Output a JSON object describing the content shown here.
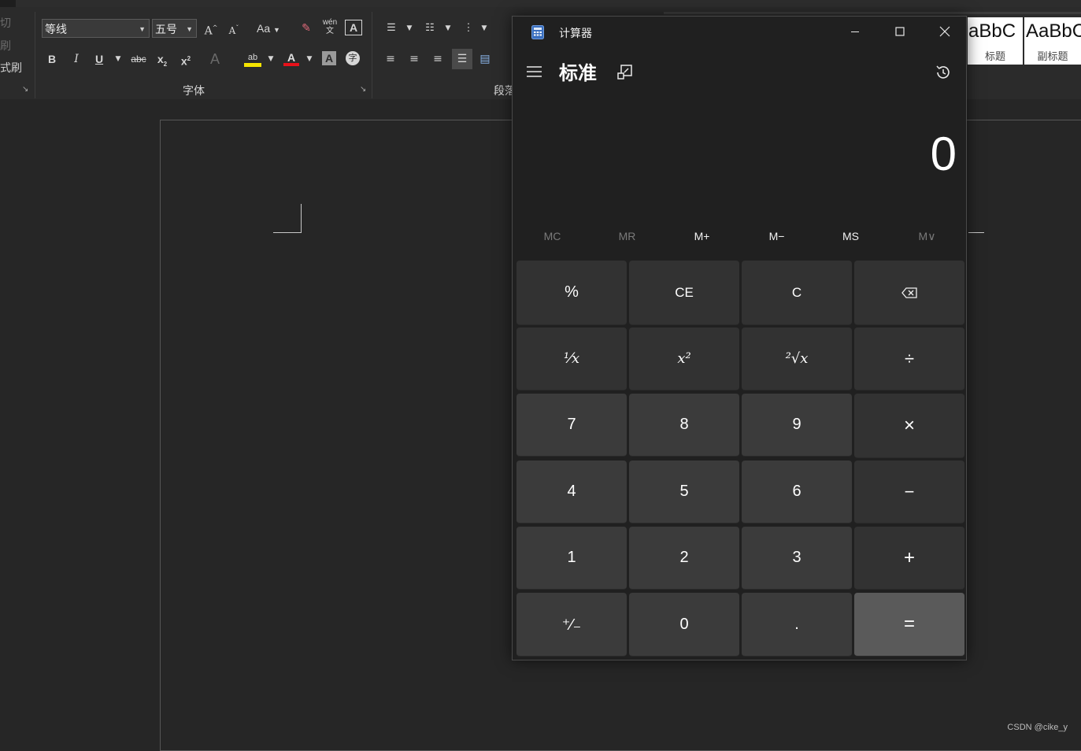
{
  "word": {
    "clipboard_fragments": [
      "切",
      "刷",
      "式刷"
    ],
    "font": {
      "name": "等线",
      "size": "五号",
      "group_label": "字体"
    },
    "paragraph": {
      "group_label": "段落"
    },
    "buttons": {
      "grow": "A",
      "shrink": "A",
      "case": "Aa",
      "bold": "B",
      "italic": "I",
      "underline": "U",
      "strike": "abc",
      "subscript": "x",
      "superscript": "x",
      "effects": "A",
      "highlight": "ab",
      "font_color": "A",
      "char_border": "A",
      "phonetic": "wén",
      "phonetic_char": "文",
      "char_shading": "A",
      "enclose": "字"
    },
    "styles": [
      {
        "sample": "aBbC",
        "name": "标题"
      },
      {
        "sample": "AaBbC",
        "name": "副标题"
      }
    ],
    "watermark": "CSDN @cike_y"
  },
  "calculator": {
    "window_title": "计算器",
    "mode": "标准",
    "display": "0",
    "memory": [
      {
        "label": "MC",
        "enabled": false
      },
      {
        "label": "MR",
        "enabled": false
      },
      {
        "label": "M+",
        "enabled": true
      },
      {
        "label": "M−",
        "enabled": true
      },
      {
        "label": "MS",
        "enabled": true
      },
      {
        "label": "M∨",
        "enabled": false
      }
    ],
    "keys": {
      "percent": "%",
      "ce": "CE",
      "c": "C",
      "reciprocal": "¹⁄x",
      "square": "x²",
      "sqrt": "²√x",
      "divide": "÷",
      "seven": "7",
      "eight": "8",
      "nine": "9",
      "multiply": "×",
      "four": "4",
      "five": "5",
      "six": "6",
      "minus": "−",
      "one": "1",
      "two": "2",
      "three": "3",
      "plus": "+",
      "negate": "⁺⁄₋",
      "zero": "0",
      "decimal": ".",
      "equals": "="
    },
    "colors": {
      "bg": "#202020",
      "fn_key": "#323232",
      "num_key": "#3b3b3b",
      "equals_key": "#5a5a5a"
    }
  }
}
